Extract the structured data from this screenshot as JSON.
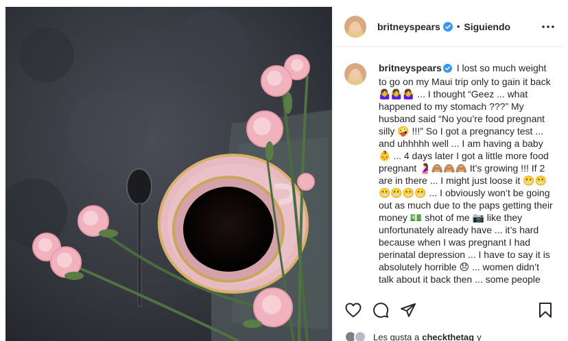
{
  "post": {
    "username": "britneyspears",
    "follow_status": "Siguiendo",
    "separator": "•",
    "caption": "I lost so much weight to go on my Maui trip only to gain it back 🤷‍♀️🤷‍♀️🤷‍♀️ ... I thought “Geez ... what happened to my stomach ???” My husband said “No you’re food pregnant silly 🤪 !!!” So I got a pregnancy test ... and uhhhhh well ... I am having a baby 👶 ... 4 days later I got a little more food pregnant 🤰🙈🙈🙈 It’s growing !!! If 2 are in there ... I might just loose it 😬😬😬😬😬😬 ... I obviously won’t be going out as much due to the paps getting their money 💵 shot of me 📷 like they unfortunately already have ... it’s hard because when I was pregnant I had perinatal depression ... I have to say it is absolutely horrible 😞 ... women didn’t talk about it back then ... some people"
  },
  "likes": {
    "prefix": "Les gusta a",
    "user": "checkthetag",
    "suffix": "y"
  },
  "icons": {
    "more": "more-options-icon",
    "like": "heart-icon",
    "comment": "comment-icon",
    "share": "share-icon",
    "save": "bookmark-icon",
    "verified": "verified-badge-icon"
  },
  "colors": {
    "verified": "#3897f0",
    "text": "#262626",
    "border": "#efefef"
  }
}
